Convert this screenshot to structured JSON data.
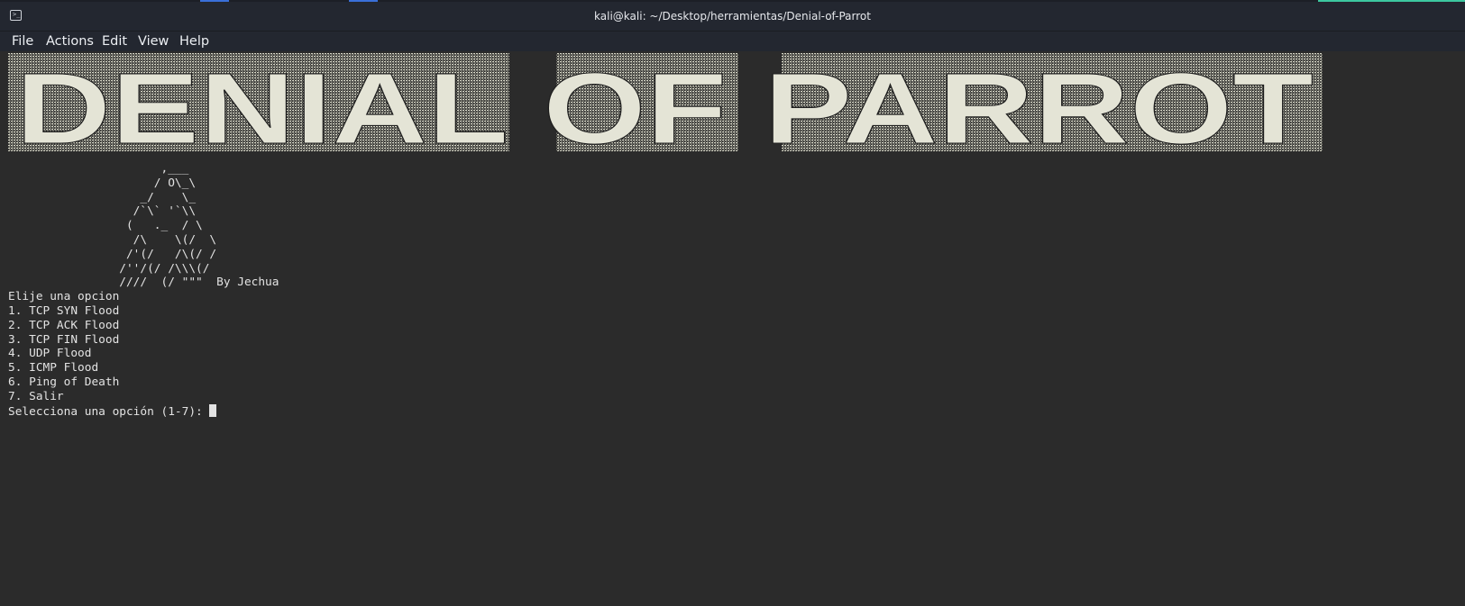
{
  "window": {
    "title": "kali@kali: ~/Desktop/herramientas/Denial-of-Parrot",
    "icon": "terminal-icon",
    "accent_colors": [
      "#3a6fd8",
      "#3a6fd8",
      "#3cc8a0"
    ]
  },
  "menubar": {
    "items": [
      "File",
      "Actions",
      "Edit",
      "View",
      "Help"
    ]
  },
  "banner": {
    "text": "DENIAL OF PARROT",
    "color": "#e4e4d6"
  },
  "terminal": {
    "ascii_art": [
      "                      ,___",
      "                     / O\\_\\",
      "                   _/    \\_",
      "                  /`\\` '`\\\\",
      "                 (   ._  / \\",
      "                  /\\    \\(/  \\",
      "                 /'(/   /\\(/ /",
      "                /''/(/ /\\\\\\(/",
      "                ////  (/ \"\"\"  By Jechua"
    ],
    "menu_title": "Elije una opcion",
    "options": [
      "1. TCP SYN Flood",
      "2. TCP ACK Flood",
      "3. TCP FIN Flood",
      "4. UDP Flood",
      "5. ICMP Flood",
      "6. Ping of Death",
      "7. Salir"
    ],
    "prompt": "Selecciona una opción (1-7): "
  }
}
